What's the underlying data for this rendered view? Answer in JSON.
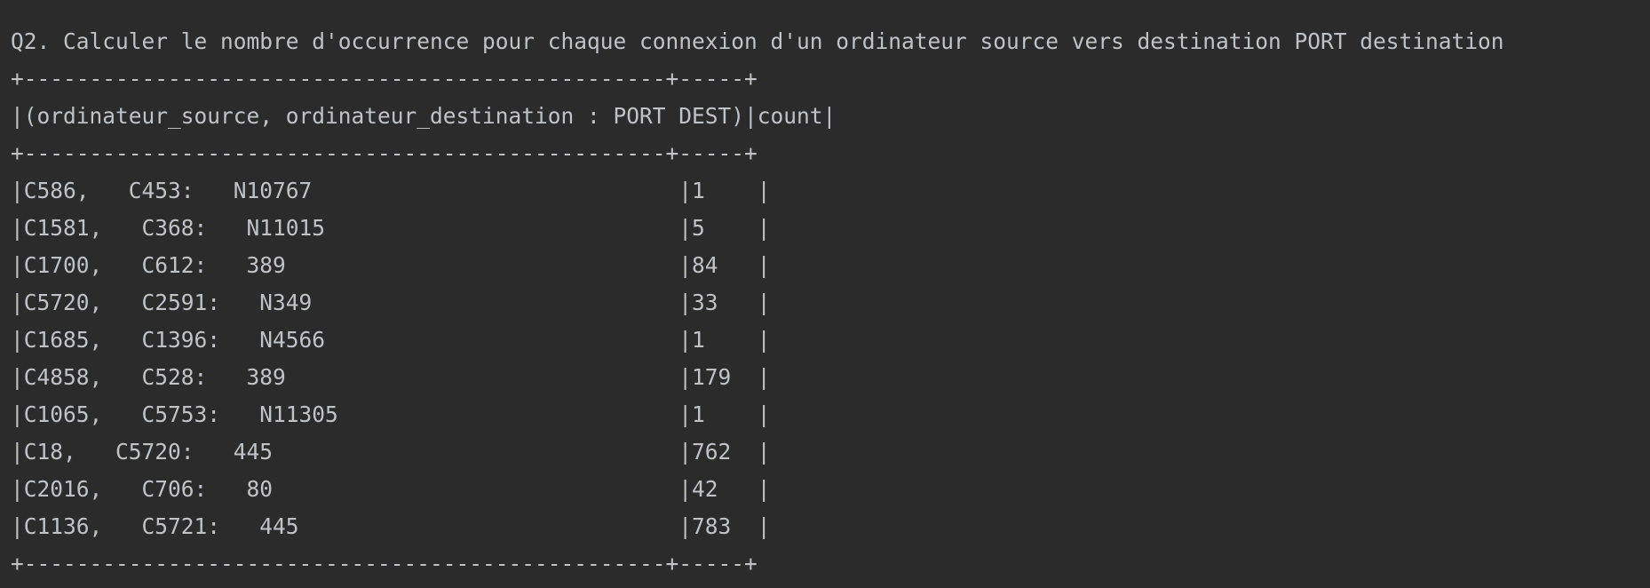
{
  "console": {
    "question": "Q2. Calculer le nombre d'occurrence pour chaque connexion d'un ordinateur source vers destination PORT destination",
    "border_top": "+-------------------------------------------------+-----+",
    "header": "|(ordinateur_source, ordinateur_destination : PORT DEST)|count|",
    "border_mid": "+-------------------------------------------------+-----+",
    "rows": [
      "|C586,   C453:   N10767                            |1    |",
      "|C1581,   C368:   N11015                           |5    |",
      "|C1700,   C612:   389                              |84   |",
      "|C5720,   C2591:   N349                            |33   |",
      "|C1685,   C1396:   N4566                           |1    |",
      "|C4858,   C528:   389                              |179  |",
      "|C1065,   C5753:   N11305                          |1    |",
      "|C18,   C5720:   445                               |762  |",
      "|C2016,   C706:   80                               |42   |",
      "|C1136,   C5721:   445                             |783  |"
    ],
    "border_bottom": "+-------------------------------------------------+-----+"
  }
}
